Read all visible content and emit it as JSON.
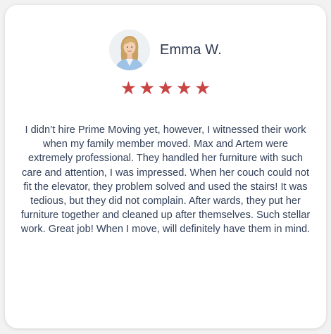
{
  "review": {
    "reviewer_name": "Emma W.",
    "avatar_icon": "person-avatar-icon",
    "rating": 5,
    "rating_max": 5,
    "star_color": "#c94543",
    "text": "I didn’t hire Prime Moving yet, however, I witnessed their work when my family member moved. Max and Artem were extremely professional. They handled her furniture with such care and attention, I was impressed. When her couch could not fit the elevator, they problem solved and used the stairs! It was tedious, but they did not complain. After wards, they put her furniture together and cleaned up after themselves. Such stellar work. Great job! When I move, will definitely have them in mind."
  }
}
